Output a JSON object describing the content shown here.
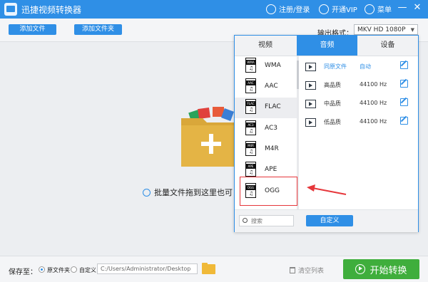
{
  "app": {
    "title": "迅捷视频转换器"
  },
  "titlebar": {
    "login_label": "注册/登录",
    "vip_label": "开通VIP",
    "menu_label": "菜单",
    "minimize_glyph": "—",
    "close_glyph": "✕"
  },
  "toolbar": {
    "add_file_label": "添加文件",
    "add_folder_label": "添加文件夹",
    "output_format_label": "输出格式：",
    "output_format_value": "MKV  HD 1080P"
  },
  "drop_area": {
    "hint": "批量文件拖到这里也可"
  },
  "popup": {
    "tabs": [
      "视频",
      "音频",
      "设备"
    ],
    "active_tab": "音频",
    "formats": [
      {
        "tag": "WMA",
        "label": "WMA"
      },
      {
        "tag": "AAC",
        "label": "AAC"
      },
      {
        "tag": "FLAC",
        "label": "FLAC"
      },
      {
        "tag": "AC3",
        "label": "AC3"
      },
      {
        "tag": "M4R",
        "label": "M4R"
      },
      {
        "tag": "APE",
        "label": "APE"
      },
      {
        "tag": "OGG",
        "label": "OGG"
      }
    ],
    "selected_format": "FLAC",
    "qualities": [
      {
        "name": "同原文件",
        "rate": "自动"
      },
      {
        "name": "高品质",
        "rate": "44100 Hz"
      },
      {
        "name": "中品质",
        "rate": "44100 Hz"
      },
      {
        "name": "低品质",
        "rate": "44100 Hz"
      }
    ],
    "search_placeholder": "搜索",
    "custom_label": "自定义"
  },
  "footer": {
    "save_to_label": "保存至：",
    "radio_original_label": "原文件夹",
    "radio_custom_label": "自定义",
    "save_path": "C:/Users/Administrator/Desktop",
    "clear_list_label": "清空列表",
    "start_label": "开始转换"
  },
  "colors": {
    "accent": "#2f8fe6",
    "start": "#3fae3c",
    "highlight": "#e6373b"
  }
}
